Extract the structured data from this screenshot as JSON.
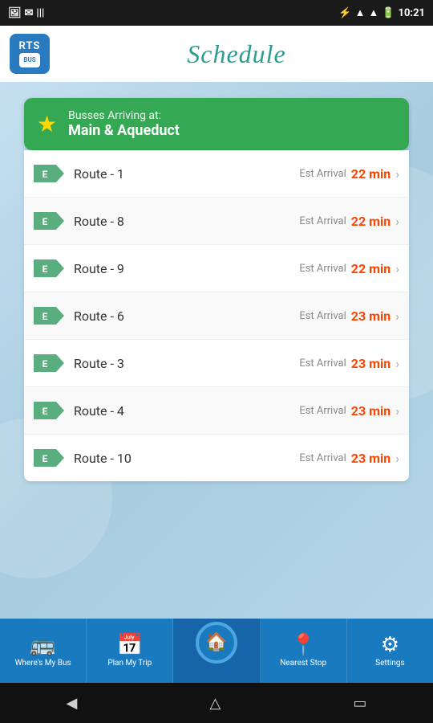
{
  "statusBar": {
    "time": "10:21",
    "icons": [
      "bluetooth",
      "wifi",
      "signal",
      "battery"
    ]
  },
  "header": {
    "logoText": "RTS",
    "logoBus": "BUS",
    "title": "Schedule"
  },
  "stopCard": {
    "arrivingLabel": "Busses Arriving at:",
    "stopName": "Main & Aqueduct"
  },
  "routes": [
    {
      "id": "1",
      "name": "Route - 1",
      "estLabel": "Est Arrival",
      "time": "22 min"
    },
    {
      "id": "2",
      "name": "Route - 8",
      "estLabel": "Est Arrival",
      "time": "22 min"
    },
    {
      "id": "3",
      "name": "Route - 9",
      "estLabel": "Est Arrival",
      "time": "22 min"
    },
    {
      "id": "4",
      "name": "Route - 6",
      "estLabel": "Est Arrival",
      "time": "23 min"
    },
    {
      "id": "5",
      "name": "Route - 3",
      "estLabel": "Est Arrival",
      "time": "23 min"
    },
    {
      "id": "6",
      "name": "Route - 4",
      "estLabel": "Est Arrival",
      "time": "23 min"
    },
    {
      "id": "7",
      "name": "Route - 10",
      "estLabel": "Est Arrival",
      "time": "23 min"
    }
  ],
  "bottomNav": [
    {
      "id": "where-my-bus",
      "icon": "🚌",
      "label": "Where's My Bus"
    },
    {
      "id": "plan-my-trip",
      "icon": "📅",
      "label": "Plan My Trip"
    },
    {
      "id": "home",
      "icon": "🏠",
      "label": ""
    },
    {
      "id": "nearest-stop",
      "icon": "📍",
      "label": "Nearest Stop"
    },
    {
      "id": "settings",
      "icon": "⚙",
      "label": "Settings"
    }
  ],
  "colors": {
    "green": "#34a853",
    "blue": "#1a7abf",
    "orange": "#ff4400",
    "badgeGreen": "#5aad7e"
  }
}
